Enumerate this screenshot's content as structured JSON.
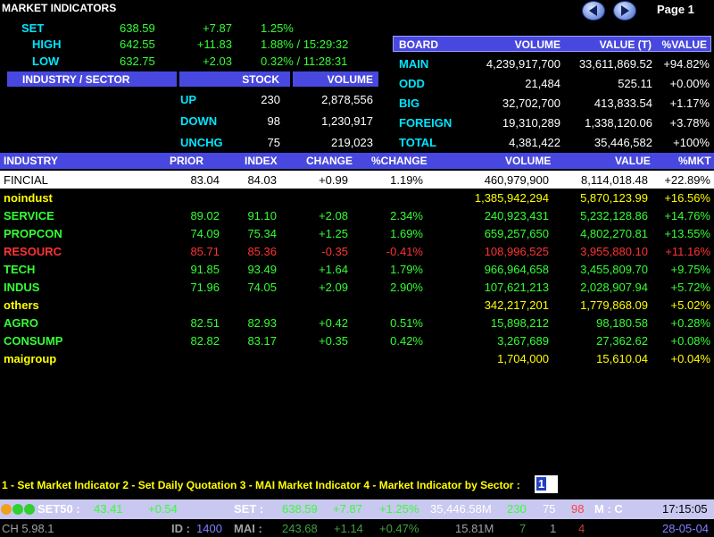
{
  "header": {
    "title": "MARKET INDICATORS",
    "page": "Page 1"
  },
  "set": {
    "set_label": "SET",
    "set_value": "638.59",
    "set_change": "+7.87",
    "set_pct": "1.25%",
    "high_label": "HIGH",
    "high_value": "642.55",
    "high_change": "+11.83",
    "high_pct": "1.88% / 15:29:32",
    "low_label": "LOW",
    "low_value": "632.75",
    "low_change": "+2.03",
    "low_pct": "0.32% / 11:28:31"
  },
  "industry_box": {
    "col_sector": "INDUSTRY / SECTOR",
    "col_stock": "STOCK",
    "col_volume": "VOLUME",
    "rows": [
      {
        "label": "UP",
        "stock": "230",
        "volume": "2,878,556"
      },
      {
        "label": "DOWN",
        "stock": "98",
        "volume": "1,230,917"
      },
      {
        "label": "UNCHG",
        "stock": "75",
        "volume": "219,023"
      }
    ]
  },
  "board": {
    "col_board": "BOARD",
    "col_volume": "VOLUME",
    "col_value": "VALUE (T)",
    "col_pct": "%VALUE",
    "rows": [
      {
        "label": "MAIN",
        "volume": "4,239,917,700",
        "value": "33,611,869.52",
        "pct": "+94.82%"
      },
      {
        "label": "ODD",
        "volume": "21,484",
        "value": "525.11",
        "pct": "+0.00%"
      },
      {
        "label": "BIG",
        "volume": "32,702,700",
        "value": "413,833.54",
        "pct": "+1.17%"
      },
      {
        "label": "FOREIGN",
        "volume": "19,310,289",
        "value": "1,338,120.06",
        "pct": "+3.78%"
      },
      {
        "label": "TOTAL",
        "volume": "4,381,422",
        "value": "35,446,582",
        "pct": "+100%"
      }
    ]
  },
  "table": {
    "headers": {
      "industry": "INDUSTRY",
      "prior": "PRIOR",
      "index": "INDEX",
      "change": "CHANGE",
      "pct_change": "%CHANGE",
      "volume": "VOLUME",
      "value": "VALUE",
      "pct_mkt": "%MKT"
    },
    "rows": [
      {
        "industry": "FINCIAL",
        "prior": "83.04",
        "index": "84.03",
        "change": "+0.99",
        "pct_change": "1.19%",
        "volume": "460,979,900",
        "value": "8,114,018.48",
        "pct_mkt": "+22.89%",
        "color": "#ffffff"
      },
      {
        "industry": "noindust",
        "prior": "",
        "index": "",
        "change": "",
        "pct_change": "",
        "volume": "1,385,942,294",
        "value": "5,870,123.99",
        "pct_mkt": "+16.56%",
        "color": "#ffff00"
      },
      {
        "industry": "SERVICE",
        "prior": "89.02",
        "index": "91.10",
        "change": "+2.08",
        "pct_change": "2.34%",
        "volume": "240,923,431",
        "value": "5,232,128.86",
        "pct_mkt": "+14.76%",
        "color": "#33ff33"
      },
      {
        "industry": "PROPCON",
        "prior": "74.09",
        "index": "75.34",
        "change": "+1.25",
        "pct_change": "1.69%",
        "volume": "659,257,650",
        "value": "4,802,270.81",
        "pct_mkt": "+13.55%",
        "color": "#33ff33"
      },
      {
        "industry": "RESOURC",
        "prior": "85.71",
        "index": "85.36",
        "change": "-0.35",
        "pct_change": "-0.41%",
        "volume": "108,996,525",
        "value": "3,955,880.10",
        "pct_mkt": "+11.16%",
        "color": "#ff3333"
      },
      {
        "industry": "TECH",
        "prior": "91.85",
        "index": "93.49",
        "change": "+1.64",
        "pct_change": "1.79%",
        "volume": "966,964,658",
        "value": "3,455,809.70",
        "pct_mkt": "+9.75%",
        "color": "#33ff33"
      },
      {
        "industry": "INDUS",
        "prior": "71.96",
        "index": "74.05",
        "change": "+2.09",
        "pct_change": "2.90%",
        "volume": "107,621,213",
        "value": "2,028,907.94",
        "pct_mkt": "+5.72%",
        "color": "#33ff33"
      },
      {
        "industry": "others",
        "prior": "",
        "index": "",
        "change": "",
        "pct_change": "",
        "volume": "342,217,201",
        "value": "1,779,868.09",
        "pct_mkt": "+5.02%",
        "color": "#ffff00"
      },
      {
        "industry": "AGRO",
        "prior": "82.51",
        "index": "82.93",
        "change": "+0.42",
        "pct_change": "0.51%",
        "volume": "15,898,212",
        "value": "98,180.58",
        "pct_mkt": "+0.28%",
        "color": "#33ff33"
      },
      {
        "industry": "CONSUMP",
        "prior": "82.82",
        "index": "83.17",
        "change": "+0.35",
        "pct_change": "0.42%",
        "volume": "3,267,689",
        "value": "27,362.62",
        "pct_mkt": "+0.08%",
        "color": "#33ff33"
      },
      {
        "industry": "maigroup",
        "prior": "",
        "index": "",
        "change": "",
        "pct_change": "",
        "volume": "1,704,000",
        "value": "15,610.04",
        "pct_mkt": "+0.04%",
        "color": "#ffff00"
      }
    ]
  },
  "menu": {
    "text": "1 - Set Market Indicator  2 - Set Daily Quotation  3 - MAI Market Indicator  4 - Market Indicator by Sector :",
    "input_value": "1"
  },
  "status1": {
    "set50_label": "SET50 :",
    "set50_value": "43.41",
    "set50_change": "+0.54",
    "set_label": "SET :",
    "set_value": "638.59",
    "set_change": "+7.87",
    "set_pct": "+1.25%",
    "volume": "35,446.58M",
    "up": "230",
    "unch": "75",
    "down": "98",
    "mode": "M : C",
    "time": "17:15:05"
  },
  "status2": {
    "ch_label": "CH 5.98.1",
    "id_label": "ID :",
    "id_value": "1400",
    "mai_label": "MAI :",
    "mai_value": "243.68",
    "mai_change": "+1.14",
    "mai_pct": "+0.47%",
    "volume": "15.81M",
    "up": "7",
    "unch": "1",
    "down": "4",
    "date": "28-05-04"
  },
  "icons": [
    "prev-page-icon",
    "next-page-icon",
    "status-lights-icon"
  ]
}
